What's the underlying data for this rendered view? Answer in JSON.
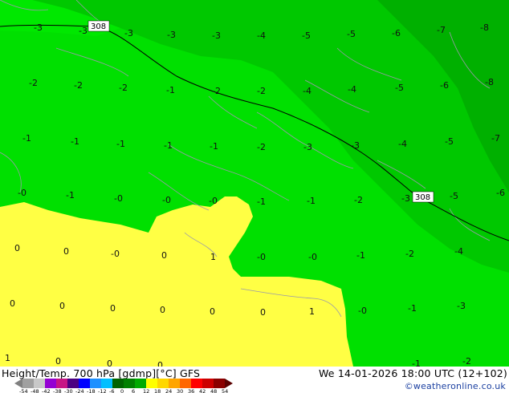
{
  "footer": {
    "title": "Height/Temp. 700 hPa [gdmp][°C] GFS",
    "valid_time": "We 14-01-2026 18:00 UTC (12+102)",
    "credit": "©weatheronline.co.uk"
  },
  "legend": {
    "scale": [
      "-54",
      "-48",
      "-42",
      "-38",
      "-30",
      "-24",
      "-18",
      "-12",
      "-6",
      "0",
      "6",
      "12",
      "18",
      "24",
      "30",
      "36",
      "42",
      "48",
      "54"
    ],
    "colors": [
      "#a0a0a0",
      "#c8c8c8",
      "#9400d3",
      "#c71585",
      "#4b0082",
      "#0000ff",
      "#1e90ff",
      "#00bfff",
      "#006400",
      "#008000",
      "#00aa00",
      "#ffff00",
      "#ffd700",
      "#ffa500",
      "#ff6600",
      "#ff0000",
      "#cc0000",
      "#8b0000"
    ]
  },
  "contours": {
    "height_labels": [
      "308",
      "308"
    ]
  },
  "temperature_labels": [
    "-3",
    "-3",
    "-3",
    "-3",
    "-3",
    "-4",
    "-5",
    "-5",
    "-6",
    "-7",
    "-8",
    "-2",
    "-2",
    "-2",
    "-1",
    "-2",
    "-2",
    "-4",
    "-4",
    "-5",
    "-6",
    "-8",
    "-1",
    "-1",
    "-1",
    "-1",
    "-1",
    "-2",
    "-3",
    "-3",
    "-4",
    "-5",
    "-7",
    "-0",
    "-1",
    "-0",
    "-0",
    "-0",
    "-1",
    "-1",
    "-2",
    "-3",
    "-5",
    "-6",
    "0",
    "0",
    "-0",
    "0",
    "1",
    "-0",
    "-0",
    "-1",
    "-2",
    "-4",
    "0",
    "0",
    "0",
    "0",
    "0",
    "0",
    "1",
    "-0",
    "-1",
    "-3",
    "1",
    "0",
    "0",
    "0",
    "-1",
    "-2"
  ]
}
